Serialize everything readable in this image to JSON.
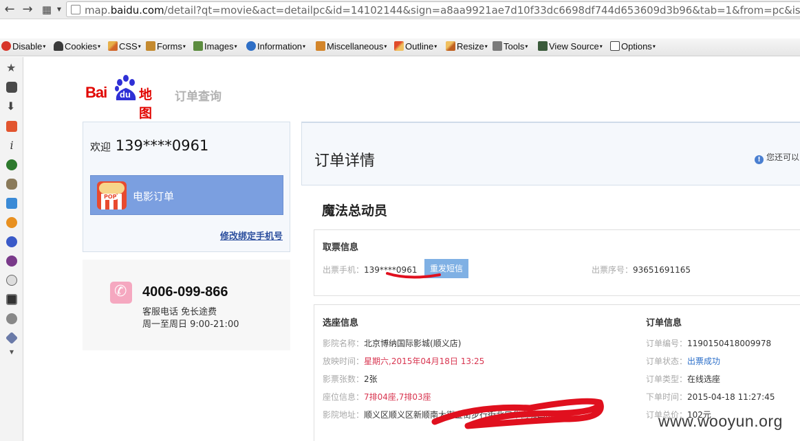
{
  "browser": {
    "url_prefix": "map.",
    "url_domain": "baidu.com",
    "url_rest": "/detail?qt=movie&act=detailpc&id=14102144&sign=a8aa9921ae7d10f33dc6698df744d653609d3b96&tab=1&from=pc&is_c_"
  },
  "devtoolbar": {
    "items": [
      {
        "label": "Disable",
        "icon": "disable-icon"
      },
      {
        "label": "Cookies",
        "icon": "cookies-icon"
      },
      {
        "label": "CSS",
        "icon": "css-icon"
      },
      {
        "label": "Forms",
        "icon": "forms-icon"
      },
      {
        "label": "Images",
        "icon": "images-icon"
      },
      {
        "label": "Information",
        "icon": "information-icon"
      },
      {
        "label": "Miscellaneous",
        "icon": "miscellaneous-icon"
      },
      {
        "label": "Outline",
        "icon": "outline-icon"
      },
      {
        "label": "Resize",
        "icon": "resize-icon"
      },
      {
        "label": "Tools",
        "icon": "tools-icon"
      },
      {
        "label": "View Source",
        "icon": "view-source-icon"
      },
      {
        "label": "Options",
        "icon": "options-icon"
      }
    ]
  },
  "header": {
    "logo_bai": "Bai",
    "logo_du": "du",
    "logo_map": "地图",
    "subtitle": "订单查询"
  },
  "sidebar": {
    "welcome": "欢迎",
    "phone": "139****0961",
    "menu_movie": "电影订单",
    "pop_label": "POP",
    "change_phone": "修改绑定手机号"
  },
  "hotline": {
    "number": "4006-099-866",
    "desc": "客服电话 免长途费",
    "hours": "周一至周日 9:00-21:00"
  },
  "order": {
    "title": "订单详情",
    "notice": "您还可以",
    "movie": "魔法总动员"
  },
  "ticket": {
    "section": "取票信息",
    "phone_label": "出票手机：",
    "phone_value": "139****0961",
    "resend": "重发短信",
    "serial_label": "出票序号：",
    "serial_value": "93651691165"
  },
  "seat": {
    "section": "选座信息",
    "cinema_label": "影院名称：",
    "cinema_value": "北京博纳国际影城(顺义店)",
    "time_label": "放映时间：",
    "time_value": "星期六,2015年04月18日 13:25",
    "count_label": "影票张数：",
    "count_value": "2张",
    "seat_label": "座位信息：",
    "seat_value": "7排04座,7排03座",
    "addr_label": "影院地址：",
    "addr_value": "顺义区顺义区新顺南大街金街步行街北口华商城四层(南)"
  },
  "orderinfo": {
    "section": "订单信息",
    "no_label": "订单编号：",
    "no_value": "1190150418009978",
    "status_label": "订单状态：",
    "status_value": "出票成功",
    "type_label": "订单类型：",
    "type_value": "在线选座",
    "time_label": "下单时间：",
    "time_value": "2015-04-18 11:27:45",
    "total_label": "订单总价：",
    "total_value": "102元"
  },
  "watermark": "www.wooyun.org",
  "colors": {
    "baidu_red": "#e10601",
    "baidu_blue": "#2f30d6",
    "menu_active": "#7b9fe0",
    "scribble": "#e0101e"
  }
}
